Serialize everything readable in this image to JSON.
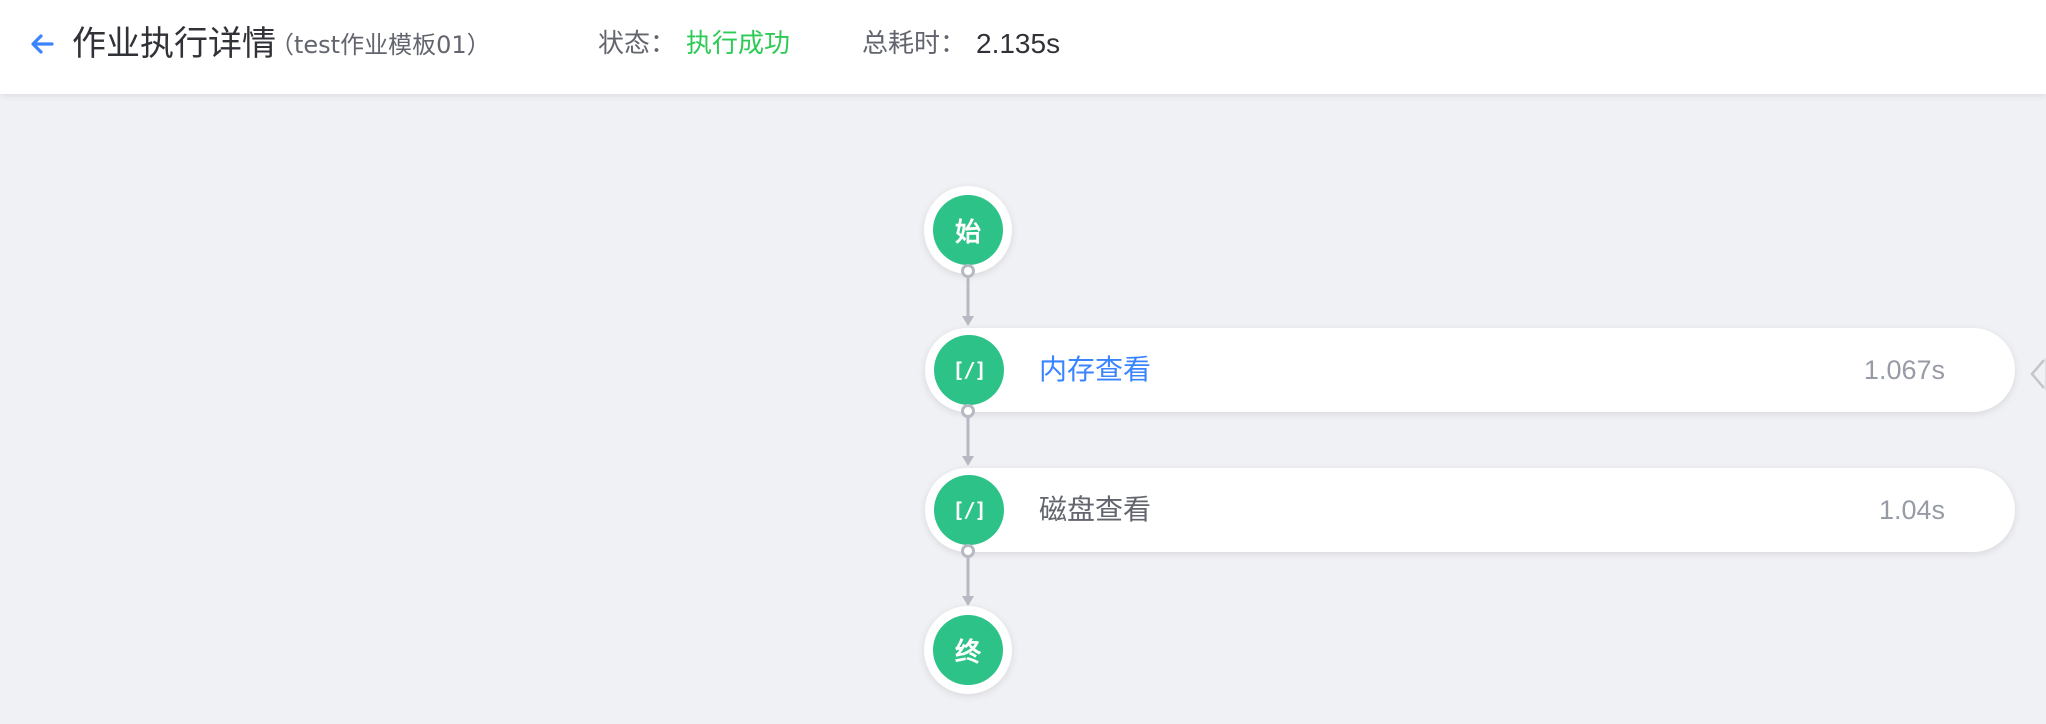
{
  "header": {
    "title": "作业执行详情",
    "subtitle": "（test作业模板01）",
    "status_label": "状态：",
    "status_value": "执行成功",
    "duration_label": "总耗时：",
    "duration_value": "2.135s"
  },
  "flow": {
    "start_label": "始",
    "end_label": "终",
    "script_glyph": "[/]",
    "steps": [
      {
        "name": "内存查看",
        "time": "1.067s",
        "active": true
      },
      {
        "name": "磁盘查看",
        "time": "1.04s",
        "active": false
      }
    ]
  },
  "colors": {
    "accent_blue": "#3a84ff",
    "success_green": "#2dcb56",
    "node_green": "#2dc287",
    "muted_text": "#63656e",
    "connector_gray": "#b6b9c1"
  },
  "icons": {
    "back": "arrow-left-icon",
    "script": "script-icon",
    "side_toggle": "chevron-left-icon"
  }
}
